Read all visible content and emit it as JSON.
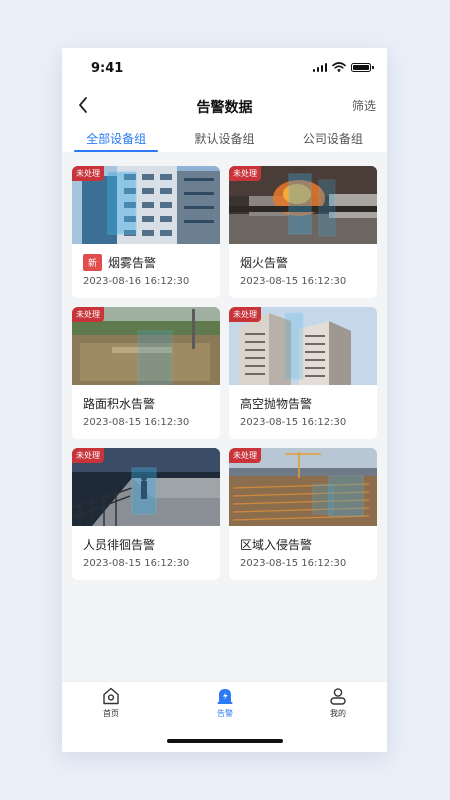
{
  "status_bar": {
    "time": "9:41"
  },
  "nav": {
    "title": "告警数据",
    "action": "筛选"
  },
  "tabs": [
    {
      "label": "全部设备组",
      "active": true
    },
    {
      "label": "默认设备组",
      "active": false
    },
    {
      "label": "公司设备组",
      "active": false
    }
  ],
  "cards": [
    {
      "status": "未处理",
      "new_badge": "新",
      "title": "烟雾告警",
      "time": "2023-08-16 16:12:30"
    },
    {
      "status": "未处理",
      "title": "烟火告警",
      "time": "2023-08-15 16:12:30"
    },
    {
      "status": "未处理",
      "title": "路面积水告警",
      "time": "2023-08-15 16:12:30"
    },
    {
      "status": "未处理",
      "title": "高空抛物告警",
      "time": "2023-08-15 16:12:30"
    },
    {
      "status": "未处理",
      "title": "人员徘徊告警",
      "time": "2023-08-15 16:12:30"
    },
    {
      "status": "未处理",
      "title": "区域入侵告警",
      "time": "2023-08-15 16:12:30"
    }
  ],
  "tab_bar": [
    {
      "label": "首页",
      "icon": "home-icon",
      "active": false
    },
    {
      "label": "告警",
      "icon": "alarm-icon",
      "active": true
    },
    {
      "label": "我的",
      "icon": "user-icon",
      "active": false
    }
  ],
  "colors": {
    "accent": "#2a7bf5",
    "alert_red": "#c9343a",
    "new_red": "#e14d4d",
    "page_bg": "#f3f4f6"
  }
}
